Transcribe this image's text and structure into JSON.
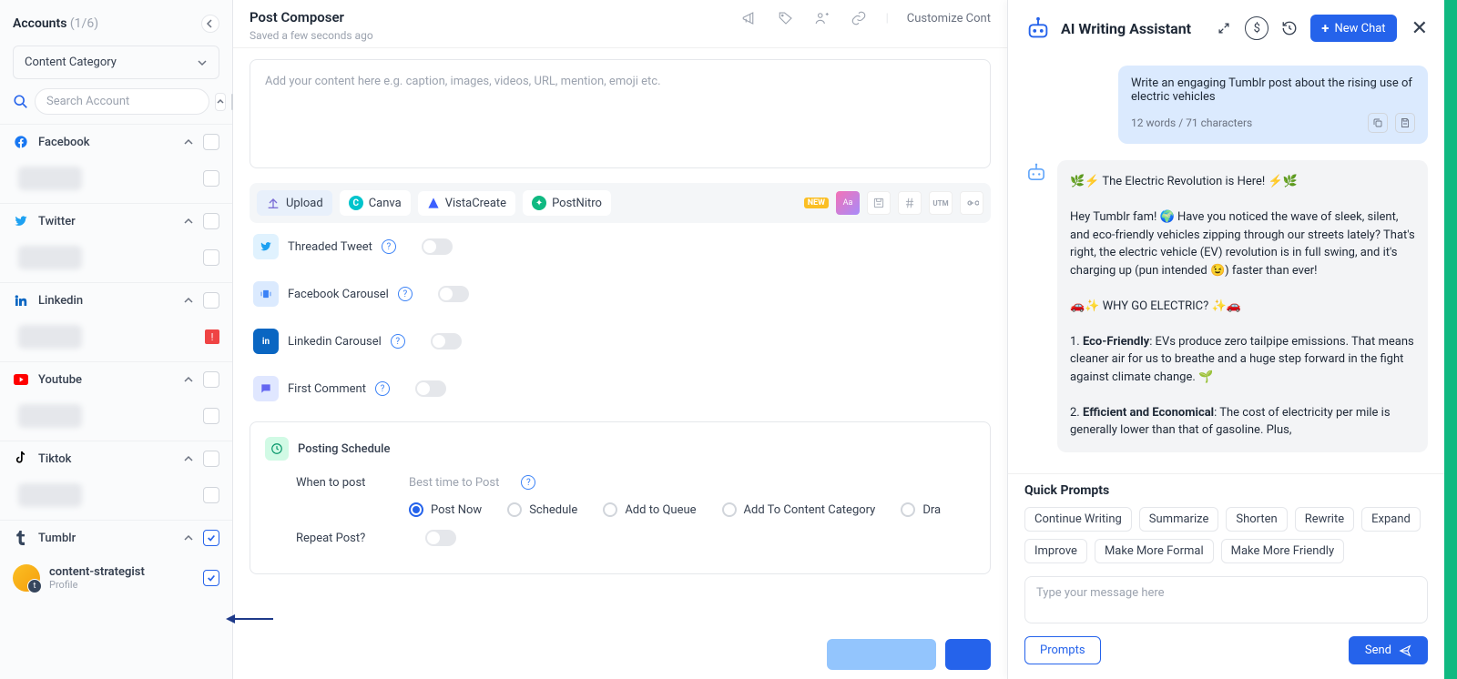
{
  "sidebar": {
    "title": "Accounts",
    "count": "(1/6)",
    "category_label": "Content Category",
    "search_placeholder": "Search Account",
    "networks": [
      {
        "key": "facebook",
        "label": "Facebook"
      },
      {
        "key": "twitter",
        "label": "Twitter"
      },
      {
        "key": "linkedin",
        "label": "Linkedin"
      },
      {
        "key": "youtube",
        "label": "Youtube"
      },
      {
        "key": "tiktok",
        "label": "Tiktok"
      },
      {
        "key": "tumblr",
        "label": "Tumblr"
      }
    ],
    "tumblr_account": {
      "name": "content-strategist",
      "sub": "Profile"
    }
  },
  "composer": {
    "title": "Post Composer",
    "saved": "Saved a few seconds ago",
    "customize": "Customize Cont",
    "placeholder": "Add your content here e.g. caption, images, videos, URL, mention, emoji etc.",
    "attach": {
      "upload": "Upload",
      "canva": "Canva",
      "vista": "VistaCreate",
      "postnitro": "PostNitro",
      "new": "NEW",
      "utm": "UTM"
    },
    "toggles": {
      "threaded": "Threaded Tweet",
      "fbcar": "Facebook Carousel",
      "licar": "Linkedin Carousel",
      "first": "First Comment"
    },
    "schedule": {
      "title": "Posting Schedule",
      "when_label": "When to post",
      "best": "Best time to Post",
      "repeat_label": "Repeat Post?",
      "options": [
        "Post Now",
        "Schedule",
        "Add to Queue",
        "Add To Content Category",
        "Dra"
      ]
    }
  },
  "assistant": {
    "title": "AI Writing Assistant",
    "newchat": "New Chat",
    "user_prompt": "Write an engaging Tumblr post about the rising use of electric vehicles",
    "user_meta": "12 words / 71 characters",
    "ai_lines": {
      "l1": "🌿⚡ The Electric Revolution is Here! ⚡🌿",
      "l2": "Hey Tumblr fam! 🌍 Have you noticed the wave of sleek, silent, and eco-friendly vehicles zipping through our streets lately? That's right, the electric vehicle (EV) revolution is in full swing, and it's charging up (pun intended 😉) faster than ever!",
      "l3": "🚗✨ WHY GO ELECTRIC? ✨🚗",
      "l4a": "1. ",
      "l4b": "Eco-Friendly",
      "l4c": ": EVs produce zero tailpipe emissions. That means cleaner air for us to breathe and a huge step forward in the fight against climate change. 🌱",
      "l5a": "2. ",
      "l5b": "Efficient and Economical",
      "l5c": ": The cost of electricity per mile is generally lower than that of gasoline. Plus,"
    },
    "quick_title": "Quick Prompts",
    "chips": [
      "Continue Writing",
      "Summarize",
      "Shorten",
      "Rewrite",
      "Expand",
      "Improve",
      "Make More Formal",
      "Make More Friendly"
    ],
    "input_placeholder": "Type your message here",
    "prompts_btn": "Prompts",
    "send_btn": "Send"
  }
}
